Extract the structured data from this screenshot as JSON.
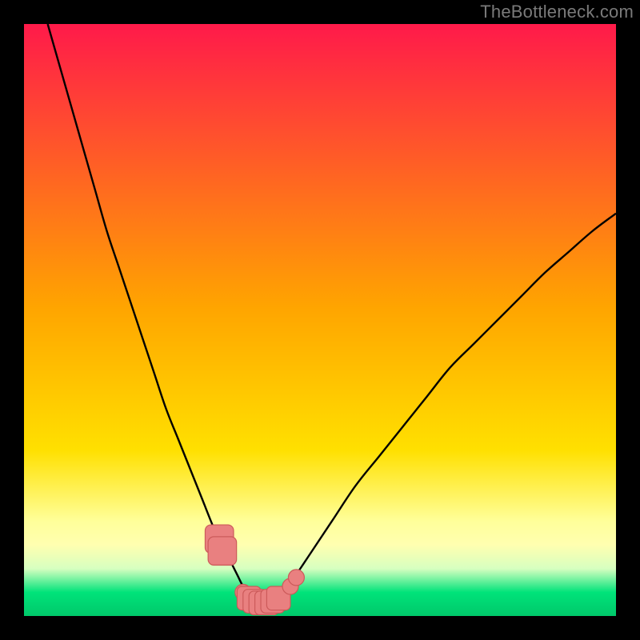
{
  "watermark": "TheBottleneck.com",
  "colors": {
    "frame": "#000000",
    "grad_top": "#ff1a4a",
    "grad_mid": "#ffd400",
    "grad_yellow_pale": "#ffff9a",
    "grad_green_pale": "#b6ffad",
    "grad_green": "#00e37a",
    "grad_green_deep": "#00c86a",
    "curve": "#000000",
    "markers_fill": "#e98080",
    "markers_stroke": "#cc5a5a"
  },
  "chart_data": {
    "type": "line",
    "title": "",
    "xlabel": "",
    "ylabel": "",
    "xlim": [
      0,
      100
    ],
    "ylim": [
      0,
      100
    ],
    "series": [
      {
        "name": "bottleneck-curve",
        "x": [
          4,
          6,
          8,
          10,
          12,
          14,
          16,
          18,
          20,
          22,
          24,
          26,
          28,
          30,
          32,
          33,
          34,
          35,
          36,
          37,
          38,
          39,
          40,
          41,
          42,
          44,
          46,
          48,
          52,
          56,
          60,
          64,
          68,
          72,
          76,
          80,
          84,
          88,
          92,
          96,
          100
        ],
        "y": [
          100,
          93,
          86,
          79,
          72,
          65,
          59,
          53,
          47,
          41,
          35,
          30,
          25,
          20,
          15,
          13,
          11,
          9,
          7,
          5,
          3.5,
          2.5,
          2,
          2,
          2.5,
          4,
          7,
          10,
          16,
          22,
          27,
          32,
          37,
          42,
          46,
          50,
          54,
          58,
          61.5,
          65,
          68
        ]
      }
    ],
    "markers": [
      {
        "shape": "rect",
        "x": 33.0,
        "y": 13.0,
        "size": 2.4
      },
      {
        "shape": "rect",
        "x": 33.5,
        "y": 11.0,
        "size": 2.4
      },
      {
        "shape": "circle",
        "x": 37.0,
        "y": 4.0,
        "size": 1.5
      },
      {
        "shape": "rect",
        "x": 38.0,
        "y": 3.0,
        "size": 2.0
      },
      {
        "shape": "rect",
        "x": 39.0,
        "y": 2.5,
        "size": 2.0
      },
      {
        "shape": "rect",
        "x": 40.0,
        "y": 2.2,
        "size": 2.0
      },
      {
        "shape": "rect",
        "x": 41.0,
        "y": 2.2,
        "size": 2.0
      },
      {
        "shape": "rect",
        "x": 42.0,
        "y": 2.5,
        "size": 2.0
      },
      {
        "shape": "rect",
        "x": 43.0,
        "y": 3.0,
        "size": 2.0
      },
      {
        "shape": "circle",
        "x": 45.0,
        "y": 5.0,
        "size": 1.5
      },
      {
        "shape": "circle",
        "x": 46.0,
        "y": 6.5,
        "size": 1.5
      }
    ]
  }
}
